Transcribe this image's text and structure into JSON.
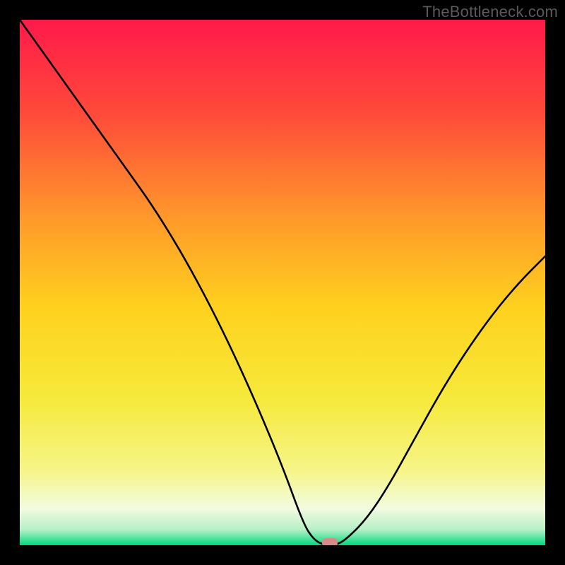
{
  "watermark": "TheBottleneck.com",
  "chart_data": {
    "type": "line",
    "title": "",
    "xlabel": "",
    "ylabel": "",
    "xlim": [
      0,
      100
    ],
    "ylim": [
      0,
      100
    ],
    "grid": false,
    "gradient_colors": {
      "top": "#ff1a4a",
      "upper_mid": "#ff7a2d",
      "mid": "#ffd21e",
      "lower_mid": "#f6f58a",
      "bottom_band": "#f2fbe0",
      "bottom": "#00d97e"
    },
    "series": [
      {
        "name": "bottleneck-curve",
        "x": [
          0,
          5,
          10,
          15,
          20,
          25,
          30,
          35,
          40,
          45,
          50,
          54,
          56,
          58,
          60,
          62,
          66,
          70,
          75,
          80,
          85,
          90,
          95,
          100
        ],
        "y": [
          100,
          93,
          86,
          79,
          72,
          65,
          57,
          48,
          38,
          27,
          15,
          4,
          1,
          0,
          0,
          1,
          5,
          11,
          20,
          29,
          37,
          44,
          50,
          55
        ]
      }
    ],
    "marker": {
      "x": 59,
      "y": 0.5,
      "color": "#d98a86"
    },
    "annotations": []
  }
}
